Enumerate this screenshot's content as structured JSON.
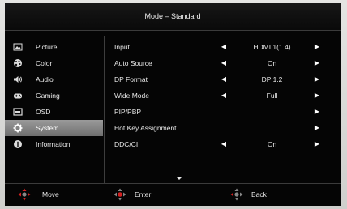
{
  "header": {
    "title": "Mode – Standard"
  },
  "sidebar": {
    "items": [
      {
        "label": "Picture",
        "icon": "picture-icon"
      },
      {
        "label": "Color",
        "icon": "color-palette-icon"
      },
      {
        "label": "Audio",
        "icon": "speaker-icon"
      },
      {
        "label": "Gaming",
        "icon": "gamepad-icon"
      },
      {
        "label": "OSD",
        "icon": "osd-window-icon"
      },
      {
        "label": "System",
        "icon": "gear-icon",
        "active": true
      },
      {
        "label": "Information",
        "icon": "info-icon"
      }
    ]
  },
  "settings": {
    "rows": [
      {
        "label": "Input",
        "value": "HDMI 1(1.4)",
        "left_arrow": "◀",
        "right_arrow": "▶"
      },
      {
        "label": "Auto Source",
        "value": "On",
        "left_arrow": "◀",
        "right_arrow": "▶"
      },
      {
        "label": "DP Format",
        "value": "DP 1.2",
        "left_arrow": "◀",
        "right_arrow": "▶"
      },
      {
        "label": "Wide Mode",
        "value": "Full",
        "left_arrow": "◀",
        "right_arrow": "▶"
      },
      {
        "label": "PIP/PBP",
        "value": "",
        "left_arrow": "",
        "right_arrow": "▶"
      },
      {
        "label": "Hot Key Assignment",
        "value": "",
        "left_arrow": "",
        "right_arrow": "▶"
      },
      {
        "label": "DDC/CI",
        "value": "On",
        "left_arrow": "◀",
        "right_arrow": "▶"
      }
    ]
  },
  "footer": {
    "move_label": "Move",
    "enter_label": "Enter",
    "back_label": "Back"
  },
  "colors": {
    "accent": "#d42020",
    "active_bg": "#8a8a8a",
    "screen_bg": "#050505"
  }
}
